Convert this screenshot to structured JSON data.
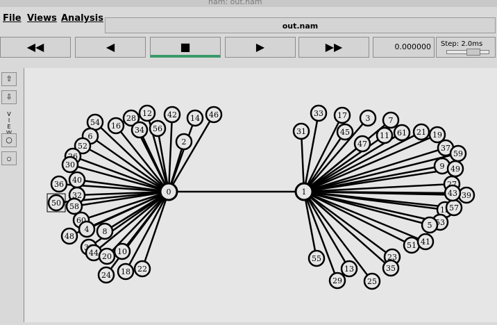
{
  "window": {
    "title": "nam: out.nam"
  },
  "menu": {
    "file": "File",
    "views": "Views",
    "analysis": "Analysis"
  },
  "file_label": "out.nam",
  "controls": {
    "rewind_icon": "double-left-arrow",
    "back_icon": "left-arrow",
    "stop_icon": "stop-square",
    "play_icon": "right-arrow",
    "forward_icon": "double-right-arrow"
  },
  "time": "0.000000",
  "step": "Step: 2.0ms",
  "sidebar": {
    "view_label": "VIEW"
  },
  "topology": {
    "link": [
      "0",
      "1"
    ],
    "node0_neighbors": [
      "54",
      "16",
      "28",
      "34",
      "12",
      "56",
      "42",
      "2",
      "14",
      "46",
      "6",
      "52",
      "26",
      "30",
      "36",
      "40",
      "32",
      "50",
      "58",
      "60",
      "4",
      "8",
      "48",
      "38",
      "44",
      "20",
      "10",
      "24",
      "18",
      "22"
    ],
    "node1_neighbors": [
      "31",
      "33",
      "17",
      "45",
      "3",
      "7",
      "11",
      "61",
      "21",
      "19",
      "47",
      "37",
      "59",
      "9",
      "49",
      "27",
      "39",
      "15",
      "57",
      "53",
      "5",
      "51",
      "41",
      "43",
      "23",
      "35",
      "25",
      "13",
      "29",
      "55"
    ],
    "highlighted_node": "50"
  }
}
